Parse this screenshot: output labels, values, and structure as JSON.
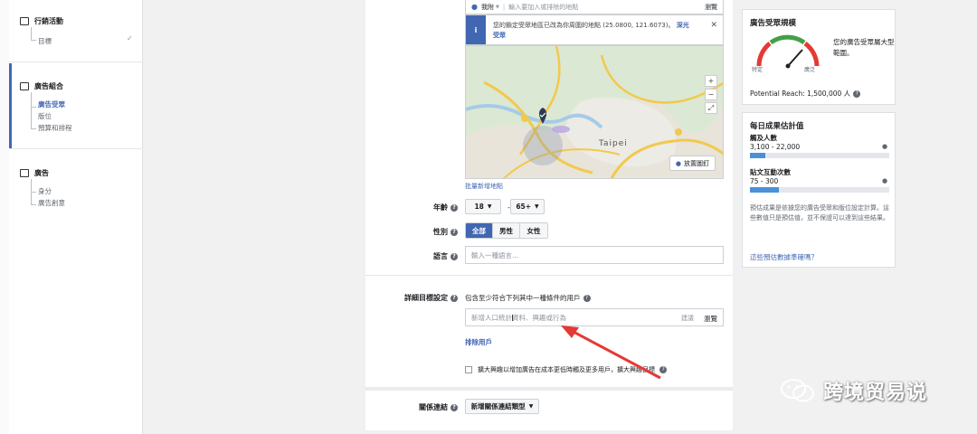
{
  "leftnav": {
    "sections": [
      {
        "title": "行銷活動",
        "items": [
          "目標"
        ]
      },
      {
        "title": "廣告組合",
        "items": [
          "廣告受眾",
          "版位",
          "預算和排程"
        ],
        "active_item": 0
      },
      {
        "title": "廣告",
        "items": [
          "身分",
          "廣告創意"
        ]
      }
    ]
  },
  "location": {
    "tag": "我附",
    "placeholder": "輸入要加入或排除的地點",
    "browse": "瀏覽"
  },
  "notice": {
    "text": "您的鎖定受眾地區已改為你周圍的地點 (25.0800, 121.6073)。",
    "link": "深光受眾"
  },
  "map": {
    "city_label": "Taipei",
    "drop_pin": "放置圖釘",
    "zoom_in": "+",
    "zoom_out": "−",
    "fullscreen": "⤢"
  },
  "bulk_link": "批量新增地點",
  "age": {
    "label": "年齡",
    "min": "18",
    "max": "65+",
    "dash": "-"
  },
  "gender": {
    "label": "性別",
    "options": [
      "全部",
      "男性",
      "女性"
    ],
    "selected": 0
  },
  "language": {
    "label": "語言",
    "placeholder": "輸入一種語言..."
  },
  "detailed": {
    "label": "詳細目標設定",
    "desc": "包含至少符合下列其中一種條件的用戶",
    "placeholder": "新增人口統計資料、興趣或行為",
    "suggest": "建議",
    "browse": "瀏覽",
    "exclude_link": "排除用戶",
    "expand_text": "擴大興趣以增加廣告在成本更低時觸及更多用戶，擴大興趣目標 "
  },
  "connections": {
    "label": "關係連結",
    "button": "新增關係連結類型"
  },
  "audience_card": {
    "title": "廣告受眾規模",
    "note": "您的廣告受眾屬大型範圍。",
    "left_label": "特定",
    "right_label": "廣泛",
    "reach": "Potential Reach: 1,500,000 人"
  },
  "daily_card": {
    "title": "每日成果估計值",
    "reach_label": "觸及人數",
    "reach_value": "3,100 - 22,000",
    "reach_fill": 0.11,
    "clicks_label": "貼文互動次數",
    "clicks_value": "75 - 300",
    "clicks_fill": 0.21,
    "note": "預估成果是依據您的廣告受眾和版位設定計算。這些數值只是預估值，並不保證可以達到這些結果。",
    "link": "這些預估數據準確嗎？"
  },
  "watermark": {
    "text": "跨境贸易说"
  }
}
